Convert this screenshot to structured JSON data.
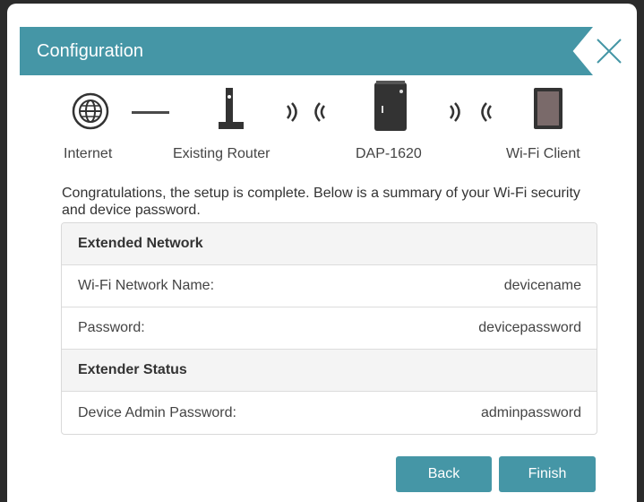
{
  "dialog": {
    "title": "Configuration"
  },
  "diagram": {
    "devices": [
      {
        "label": "Internet",
        "icon": "globe-icon"
      },
      {
        "label": "Existing Router",
        "icon": "router-icon"
      },
      {
        "label": "DAP-1620",
        "icon": "extender-icon"
      },
      {
        "label": "Wi-Fi Client",
        "icon": "tablet-icon"
      }
    ]
  },
  "intro_text": "Congratulations, the setup is complete. Below is a summary of your Wi-Fi security and device password.",
  "summary": {
    "extended_network_heading": "Extended Network",
    "wifi_name_label": "Wi-Fi Network Name:",
    "wifi_name_value": "devicename",
    "password_label": "Password:",
    "password_value": "devicepassword",
    "extender_status_heading": "Extender Status",
    "admin_password_label": "Device Admin Password:",
    "admin_password_value": "adminpassword"
  },
  "buttons": {
    "back": "Back",
    "finish": "Finish"
  },
  "colors": {
    "accent": "#4596a6",
    "icon_dark": "#333333"
  }
}
